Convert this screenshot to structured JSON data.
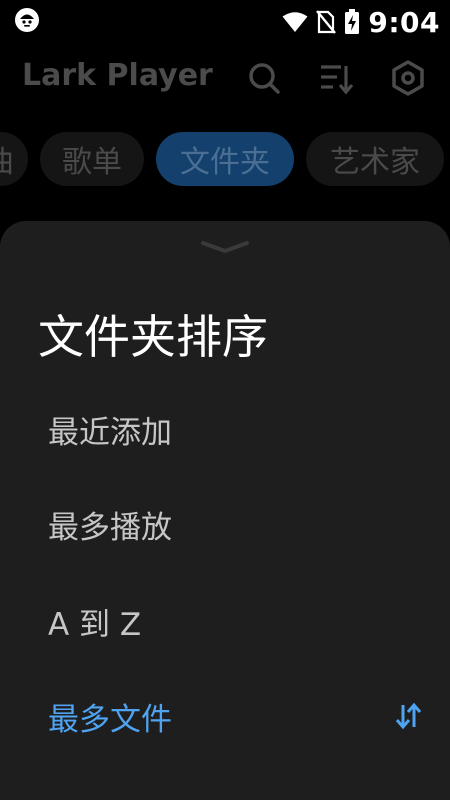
{
  "status_bar": {
    "time": "9:04",
    "icons": [
      "app-notification-icon",
      "wifi-icon",
      "no-sim-icon",
      "battery-charging-icon"
    ]
  },
  "header": {
    "title": "Lark Player",
    "icons": [
      "search-icon",
      "sort-icon",
      "settings-icon"
    ]
  },
  "tabs": [
    {
      "label": "曲"
    },
    {
      "label": "歌单"
    },
    {
      "label": "文件夹",
      "active": true
    },
    {
      "label": "艺术家"
    }
  ],
  "sheet": {
    "title": "文件夹排序",
    "options": [
      {
        "label": "最近添加"
      },
      {
        "label": "最多播放"
      },
      {
        "label": "A 到 Z"
      },
      {
        "label": "最多文件",
        "selected": true
      }
    ],
    "colors": {
      "accent": "#4fa3f1",
      "sheet_bg": "#1e1e1e"
    }
  }
}
